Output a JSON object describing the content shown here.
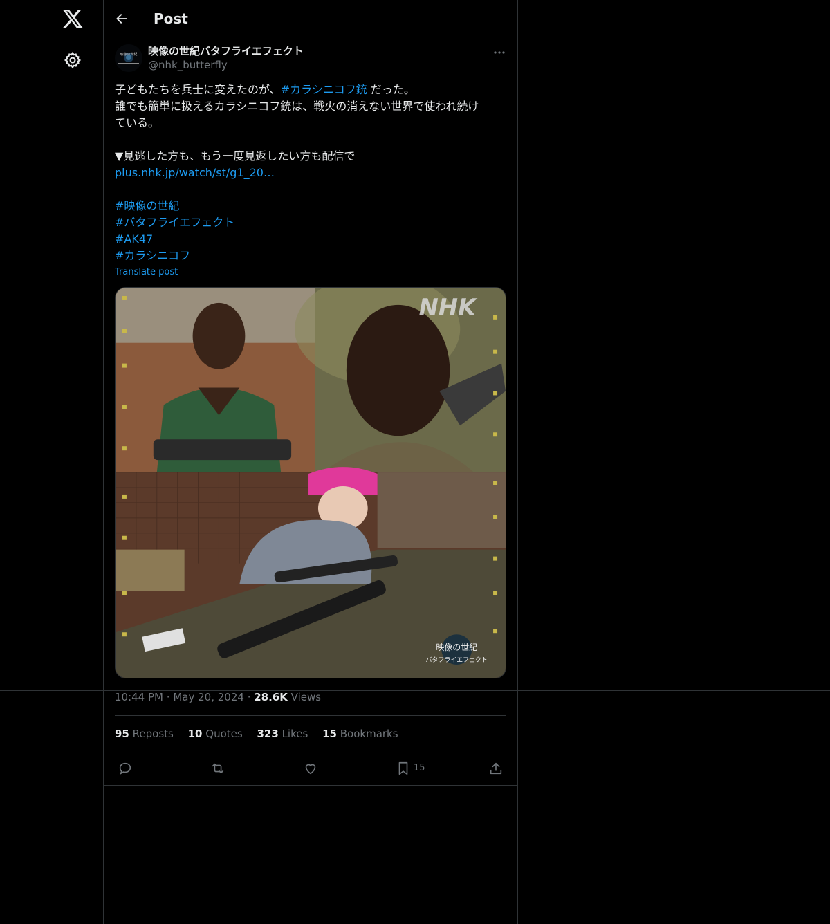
{
  "nav": {
    "logo_icon": "x-logo-icon",
    "settings_icon": "gear-icon"
  },
  "header": {
    "title": "Post",
    "back_icon": "arrow-left-icon"
  },
  "author": {
    "display_name": "映像の世紀バタフライエフェクト",
    "handle": "@nhk_butterfly",
    "avatar_text": "映像の世紀"
  },
  "post": {
    "line1_prefix": "子どもたちを兵士に変えたのが、",
    "line1_hashtag": "#カラシニコフ銃",
    "line1_suffix": " だった。",
    "line2": "誰でも簡単に扱えるカラシニコフ銃は、戦火の消えない世界で使われ続け",
    "line3": "ている。",
    "line4": "▼見逃した方も、もう一度見返したい方も配信で",
    "link": "plus.nhk.jp/watch/st/g1_20…",
    "hashtags": [
      "#映像の世紀",
      "#バタフライエフェクト",
      "#AK47",
      "#カラシニコフ"
    ],
    "translate": "Translate post"
  },
  "media": {
    "watermark": "NHK",
    "logo_line1": "映像の世紀",
    "logo_line2": "バタフライエフェクト"
  },
  "meta": {
    "time": "10:44 PM",
    "dot": "·",
    "date": "May 20, 2024",
    "views_count": "28.6K",
    "views_label": "Views"
  },
  "stats": {
    "reposts_count": "95",
    "reposts_label": "Reposts",
    "quotes_count": "10",
    "quotes_label": "Quotes",
    "likes_count": "323",
    "likes_label": "Likes",
    "bookmarks_count": "15",
    "bookmarks_label": "Bookmarks"
  },
  "actions": {
    "reply_icon": "reply-icon",
    "repost_icon": "repost-icon",
    "like_icon": "heart-icon",
    "bookmark_icon": "bookmark-icon",
    "bookmark_count": "15",
    "share_icon": "share-icon"
  }
}
